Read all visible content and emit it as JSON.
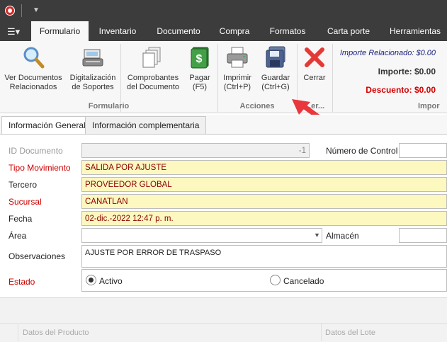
{
  "ribbon_tabs": [
    "Formulario",
    "Inventario",
    "Documento",
    "Compra",
    "Formatos",
    "Carta porte",
    "Herramientas"
  ],
  "ribbon": {
    "buttons": {
      "ver_docs": "Ver Documentos\nRelacionados",
      "digitalizacion": "Digitalización\nde Soportes",
      "comprobantes": "Comprobantes\ndel Documento",
      "pagar": "Pagar\n(F5)",
      "imprimir": "Imprimir\n(Ctrl+P)",
      "guardar": "Guardar\n(Ctrl+G)",
      "cerrar": "Cerrar"
    },
    "groups": {
      "formulario": "Formulario",
      "acciones": "Acciones",
      "truncated": "...er..."
    },
    "summary": {
      "importe_relacionado": "Importe Relacionado: $0.00",
      "importe": "Importe: $0.00",
      "descuento": "Descuento: $0.00",
      "group_label": "Impor"
    }
  },
  "form_tabs": {
    "general": "Información General",
    "complementaria": "Información complementaria"
  },
  "form": {
    "id_documento": {
      "label": "ID Documento",
      "value": "-1"
    },
    "numero_control": {
      "label": "Número de Control",
      "value": ""
    },
    "tipo_movimiento": {
      "label": "Tipo Movimiento",
      "value": "SALIDA POR AJUSTE"
    },
    "tercero": {
      "label": "Tercero",
      "value": "PROVEEDOR GLOBAL"
    },
    "sucursal": {
      "label": "Sucursal",
      "value": "CANATLAN"
    },
    "fecha": {
      "label": "Fecha",
      "value": "02-dic.-2022 12:47 p. m."
    },
    "area": {
      "label": "Área",
      "value": ""
    },
    "almacen": {
      "label": "Almacén",
      "value": ""
    },
    "observaciones": {
      "label": "Observaciones",
      "value": "AJUSTE POR ERROR DE TRASPASO"
    },
    "estado": {
      "label": "Estado",
      "activo": "Activo",
      "cancelado": "Cancelado",
      "selected": "Activo"
    }
  },
  "grid": {
    "producto": "Datos del Producto",
    "lote": "Datos del Lote"
  },
  "colors": {
    "required": "#cc0000",
    "highlight": "#fdf8c0",
    "accent_arrow": "#e8383d",
    "titlebar": "#3c3c3c"
  }
}
